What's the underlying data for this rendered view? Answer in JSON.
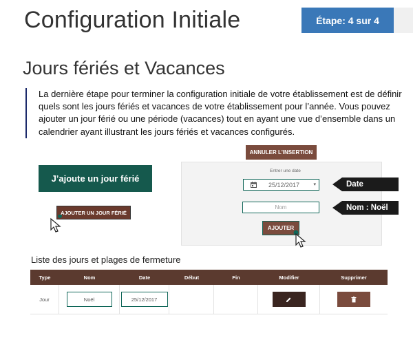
{
  "header": {
    "title": "Configuration Initiale",
    "step_label": "Étape: 4 sur 4"
  },
  "section": {
    "title": "Jours fériés et Vacances",
    "intro": "La dernière étape pour terminer la configuration initiale de votre établissement est de définir quels sont les jours fériés et vacances de votre établissement pour l’année. Vous pouvez ajouter un jour férié ou une période (vacances) tout en ayant une vue d’ensemble dans un calendrier ayant illustrant les jours fériés et vacances configurés."
  },
  "step_card": {
    "label": "J’ajoute un jour férié",
    "add_button": "AJOUTER UN JOUR FÉRIÉ"
  },
  "form": {
    "cancel_button": "ANNULER L'INSERTION",
    "date_caption": "Entrer une date",
    "date_value": "25/12/2017",
    "name_placeholder": "Nom",
    "submit_button": "AJOUTER"
  },
  "callouts": {
    "date": "Date",
    "name": "Nom : Noël"
  },
  "list": {
    "title": "Liste des jours et plages de fermeture",
    "columns": [
      "Type",
      "Nom",
      "Date",
      "Début",
      "Fin",
      "Modifier",
      "Supprimer"
    ],
    "rows": [
      {
        "type": "Jour",
        "name": "Noël",
        "date": "25/12/2017",
        "start": "",
        "end": ""
      }
    ]
  },
  "icons": {
    "calendar": "calendar-icon",
    "dropdown": "caret-down-icon",
    "edit": "pencil-icon",
    "delete": "trash-icon",
    "cursor": "mouse-pointer-icon"
  },
  "colors": {
    "step_badge": "#3a78b8",
    "green": "#15594d",
    "brown": "#7a4b3d",
    "table_header": "#5b3a2f",
    "callout": "#1b1b1b"
  }
}
